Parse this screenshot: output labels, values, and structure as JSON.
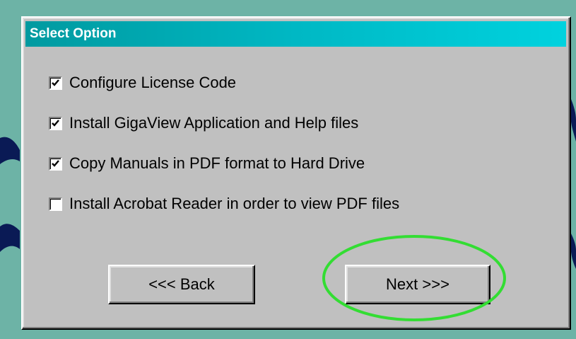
{
  "dialog": {
    "title": "Select Option"
  },
  "options": [
    {
      "label": "Configure License Code",
      "checked": true
    },
    {
      "label": "Install GigaView Application and Help files",
      "checked": true
    },
    {
      "label": "Copy Manuals in PDF format to Hard Drive",
      "checked": true
    },
    {
      "label": "Install Acrobat Reader in order to view PDF files",
      "checked": false
    }
  ],
  "buttons": {
    "back_label": "<<< Back",
    "next_label": "Next >>>"
  },
  "colors": {
    "desktop": "#6db3a6",
    "titlebar": "#00b8c4",
    "dialog": "#c0c0c0",
    "highlight": "#33dd33"
  }
}
